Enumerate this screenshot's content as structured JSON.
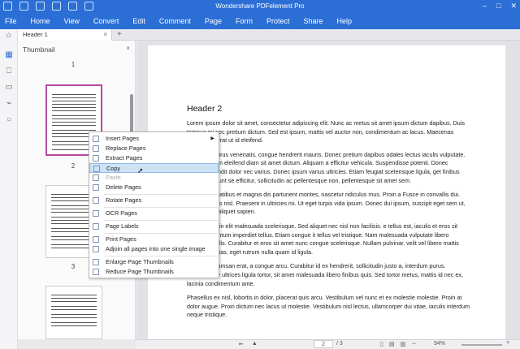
{
  "app": {
    "title": "Wondershare PDFelement Pro",
    "window_controls": [
      "–",
      "□",
      "✕"
    ]
  },
  "menu": [
    "File",
    "Home",
    "View",
    "Convert",
    "Edit",
    "Comment",
    "Page",
    "Form",
    "Protect",
    "Share",
    "Help"
  ],
  "tabs": {
    "active_label": "Header 1",
    "close": "×",
    "new": "+"
  },
  "thumbnail_panel": {
    "title": "Thumbnail",
    "close": "×",
    "page_numbers": [
      "1",
      "2",
      "3"
    ]
  },
  "context_menu": {
    "items": [
      {
        "label": "Insert Pages",
        "submenu": true,
        "state": "normal"
      },
      {
        "label": "Replace Pages",
        "state": "normal"
      },
      {
        "label": "Extract Pages",
        "state": "normal"
      },
      {
        "label": "Copy",
        "state": "highlighted"
      },
      {
        "label": "Paste",
        "state": "disabled"
      },
      {
        "label": "Delete Pages",
        "state": "normal"
      },
      {
        "label": "Rotate Pages",
        "state": "normal"
      },
      {
        "label": "OCR Pages",
        "state": "normal"
      },
      {
        "label": "Page Labels",
        "state": "normal"
      },
      {
        "label": "Print Pages",
        "state": "normal"
      },
      {
        "label": "Adjoin all pages into one single image",
        "state": "normal"
      },
      {
        "label": "Enlarge Page Thumbnails",
        "state": "normal"
      },
      {
        "label": "Reduce Page Thumbnails",
        "state": "normal"
      }
    ]
  },
  "document": {
    "heading": "Header 2",
    "paragraphs": [
      "Lorem ipsum dolor sit amet, consectetur adipiscing elit. Nunc ac metus sit amet ipsum dictum dapibus. Duis tempus mi nec pretium dictum. Sed est ipsum, mattis vel auctor non, condimentum ac lacus. Maecenas feugiat placerat ut id eleifend.",
      "dapibus a purus venenatis, congue hendrerit mauris. Donec pretium dapibus odales lectus iaculis vulputate. Donec dictum eleifend diam sit amet dictum. Aliquam a efficitur vehicula. Suspendisse potenti. Donec vehicula blandit dolor nec varius. Donec ipsum varius ultricies. Etiam feugiat scelerisque ligula, get finibus neque tincidunt se efficitur, sollicitudin ac pellentesque non, pellentesque sit amet sem.",
      "natoque penatibus et magnis dis parturient montes, nascetur ridiculus mus. Proin a Fusce in convallis dui. Sed a ultrices nisl. Praesent in ultricies mi. Ut eget turpis vida ipsum. Donec dui ipsum, suscipit eget sem ut, scelerisque aliquet sapien.",
      "gnissim orci in elit malesuada scelerisque. Sed aliquet nec nisl non facilisis. e tellus est, iaculis et eros sit amet, fermentum imperdiet tellus. Etiam congue it tellus vel tristique. Nam malesuada vulputate libero vehicula mollis. Curabitur et eros sit amet nunc congue scelerisque. Nullam pulvinar, velit vel libero mattis mauris egestas, eget rutrum nulla quam id ligula.",
      "Nunc in accumsan erat, a congue arcu. Curabitur id ex hendrerit, sollicitudin justo a, interdum purus. Suspendisse ultrices ligula tortor, sit amet malesuada libero finibus quis. Sed tortor metus, mattis id nec ex, lacinia condimentum ante.",
      "Phasellus ex nisl, lobortis in dolor, placerat quis arcu. Vestibulum vel nunc et ex molestie molestie. Proin at dolor augue. Proin dictum nec lacus ut molestie. Vestibulum nisl lectus, ullamcorper dui vitae, iaculis interdum neque tristique."
    ]
  },
  "status": {
    "page_current": "2",
    "page_total": "/ 3",
    "zoom": "94%",
    "zoom_in": "+"
  },
  "colors": {
    "brand_blue": "#2b6fd6",
    "selected_thumb_border": "#b54aa0",
    "menu_highlight": "#cfe3f7"
  }
}
